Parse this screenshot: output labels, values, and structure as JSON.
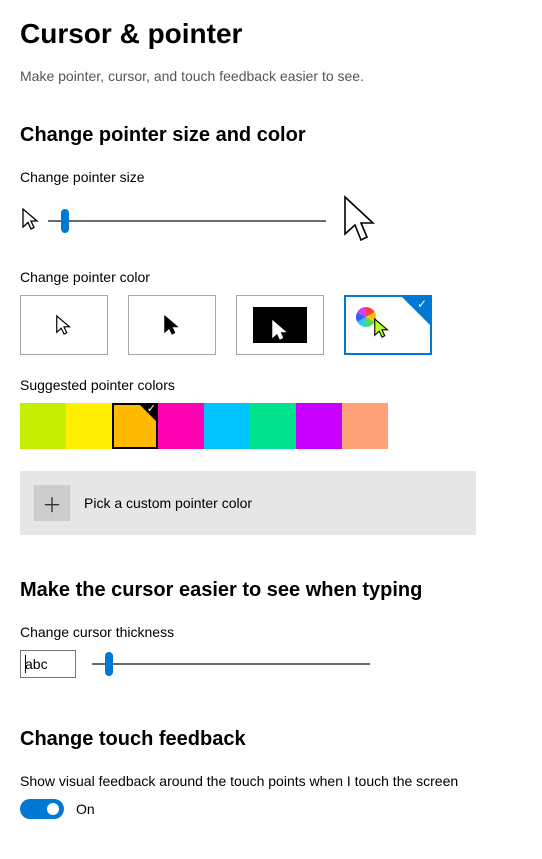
{
  "title": "Cursor & pointer",
  "subtitle": "Make pointer, cursor, and touch feedback easier to see.",
  "pointer_size": {
    "section_title": "Change pointer size and color",
    "label": "Change pointer size",
    "value": 1,
    "min": 1,
    "max": 15,
    "thumb_percent": 6
  },
  "pointer_color": {
    "label": "Change pointer color",
    "options": [
      {
        "id": "white",
        "selected": false
      },
      {
        "id": "black",
        "selected": false
      },
      {
        "id": "inverted",
        "selected": false
      },
      {
        "id": "custom",
        "selected": true
      }
    ]
  },
  "suggested": {
    "label": "Suggested pointer colors",
    "colors": [
      {
        "hex": "#c4ef00",
        "selected": false
      },
      {
        "hex": "#ffee00",
        "selected": false
      },
      {
        "hex": "#ffb900",
        "selected": true
      },
      {
        "hex": "#ff00b3",
        "selected": false
      },
      {
        "hex": "#00c3ff",
        "selected": false
      },
      {
        "hex": "#00e28e",
        "selected": false
      },
      {
        "hex": "#c700ff",
        "selected": false
      },
      {
        "hex": "#ffa179",
        "selected": false
      }
    ]
  },
  "custom_color_button": "Pick a custom pointer color",
  "cursor": {
    "section_title": "Make the cursor easier to see when typing",
    "label": "Change cursor thickness",
    "sample_text": "abc",
    "thumb_percent": 6
  },
  "touch": {
    "section_title": "Change touch feedback",
    "description": "Show visual feedback around the touch points when I touch the screen",
    "toggle_on": true,
    "toggle_label": "On"
  }
}
